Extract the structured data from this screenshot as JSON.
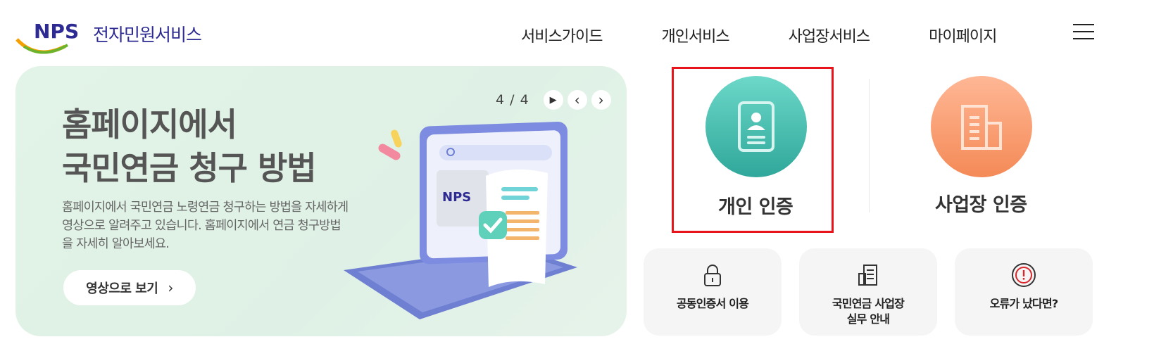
{
  "header": {
    "logo_mark": "NPS",
    "logo_text": "전자민원서비스",
    "nav": [
      "서비스가이드",
      "개인서비스",
      "사업장서비스",
      "마이페이지"
    ],
    "menu_icon": "hamburger-icon"
  },
  "banner": {
    "title_line1": "홈페이지에서",
    "title_line2": "국민연금 청구 방법",
    "description": "홈페이지에서 국민연금 노령연금 청구하는 방법을 자세하게 영상으로 알려주고 있습니다. 홈페이지에서 연금 청구방법을 자세히 알아보세요.",
    "button_label": "영상으로 보기",
    "button_chevron": "›",
    "pager": {
      "count": "4 / 4",
      "play": "▶",
      "prev": "‹",
      "next": "›"
    },
    "illustration_brand": "NPS",
    "background_color": "#e2f3e7"
  },
  "auth": {
    "personal_label": "개인 인증",
    "personal_icon": "id-card-icon",
    "personal_color": "#3ebaa9",
    "business_label": "사업장 인증",
    "business_icon": "building-icon",
    "business_color": "#f79a6b"
  },
  "cards": [
    {
      "label": "공동인증서 이용",
      "icon": "lock-icon"
    },
    {
      "label_line1": "국민연금 사업장",
      "label_line2": "실무 안내",
      "icon": "document-icon"
    },
    {
      "label": "오류가 났다면?",
      "icon": "warning-icon"
    }
  ]
}
